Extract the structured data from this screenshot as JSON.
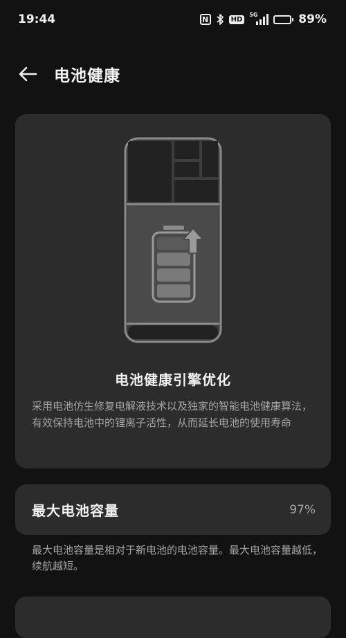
{
  "status_bar": {
    "time": "19:44",
    "network": "5G",
    "hd_label": "HD",
    "nfc_label": "N",
    "battery_percent_text": "89%",
    "battery_level": 0.89
  },
  "header": {
    "title": "电池健康"
  },
  "hero": {
    "title": "电池健康引擎优化",
    "description": "采用电池仿生修复电解液技术以及独家的智能电池健康算法，有效保持电池中的锂离子活性，从而延长电池的使用寿命"
  },
  "capacity": {
    "label": "最大电池容量",
    "value": "97%",
    "note": "最大电池容量是相对于新电池的电池容量。最大电池容量越低，续航越短。"
  },
  "colors": {
    "background": "#121212",
    "card": "#2c2c2c",
    "primary_text": "#f2f2f2",
    "secondary_text": "#a6a6a6"
  }
}
